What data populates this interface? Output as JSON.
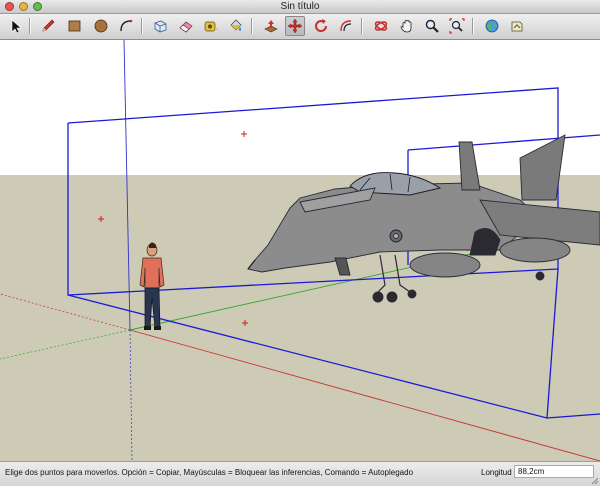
{
  "window": {
    "title": "Sin título"
  },
  "toolbar": {
    "tools": [
      {
        "name": "select-tool",
        "icon": "arrow-cursor-icon"
      },
      {
        "name": "line-tool",
        "icon": "pencil-icon"
      },
      {
        "name": "rectangle-tool",
        "icon": "rectangle-icon"
      },
      {
        "name": "circle-tool",
        "icon": "circle-icon"
      },
      {
        "name": "arc-tool",
        "icon": "arc-icon"
      },
      {
        "name": "make-component-tool",
        "icon": "component-icon"
      },
      {
        "name": "eraser-tool",
        "icon": "eraser-icon"
      },
      {
        "name": "tape-measure-tool",
        "icon": "tape-measure-icon"
      },
      {
        "name": "paint-bucket-tool",
        "icon": "paint-bucket-icon"
      },
      {
        "name": "push-pull-tool",
        "icon": "push-pull-icon"
      },
      {
        "name": "move-tool",
        "icon": "move-icon"
      },
      {
        "name": "rotate-tool",
        "icon": "rotate-icon"
      },
      {
        "name": "offset-tool",
        "icon": "offset-icon"
      },
      {
        "name": "orbit-tool",
        "icon": "orbit-icon"
      },
      {
        "name": "pan-tool",
        "icon": "hand-icon"
      },
      {
        "name": "zoom-tool",
        "icon": "magnifier-icon"
      },
      {
        "name": "zoom-extents-tool",
        "icon": "zoom-extents-icon"
      },
      {
        "name": "get-models-tool",
        "icon": "globe-icon"
      },
      {
        "name": "share-model-tool",
        "icon": "share-icon"
      }
    ],
    "active_tool": "move-tool"
  },
  "statusbar": {
    "hint": "Elige dos puntos para moverlos.  Opción = Copiar, Mayúsculas = Bloquear las inferencias, Comando = Autoplegado",
    "measure_label": "Longitud",
    "measure_value": "88,2cm"
  },
  "colors": {
    "sky": "#ffffff",
    "ground": "#cdcab6",
    "bounding_box": "#1a1ad6",
    "red_axis": "#c83232",
    "green_axis": "#2ea82e",
    "blue_axis": "#3232c8",
    "aircraft": "#8c8c8c"
  }
}
